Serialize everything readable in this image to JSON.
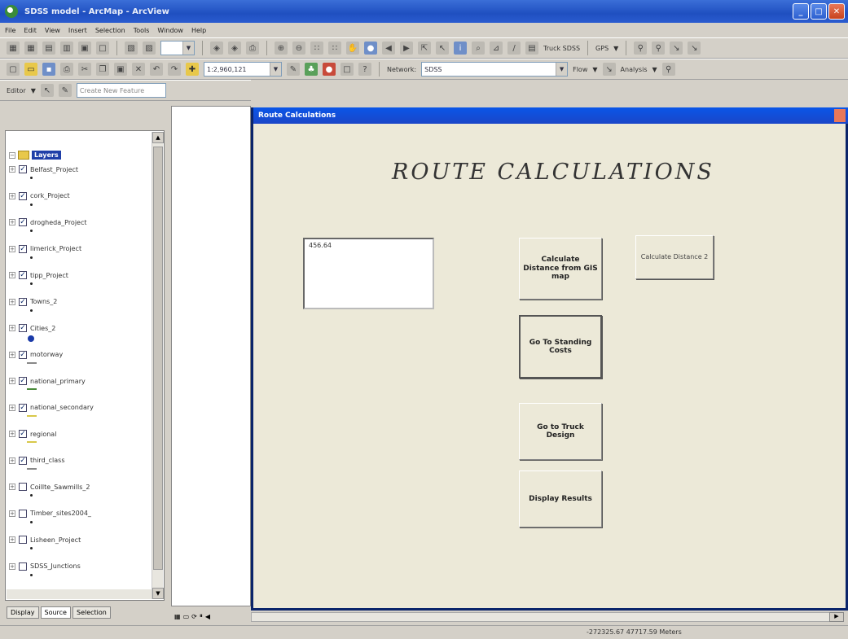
{
  "window": {
    "title": "SDSS model - ArcMap - ArcView"
  },
  "menu": [
    "File",
    "Edit",
    "View",
    "Insert",
    "Selection",
    "Tools",
    "Window",
    "Help"
  ],
  "toolbar": {
    "scale": "1:2,960,121",
    "layer_combo": "Truck SDSS",
    "gps_label": "GPS",
    "network_label": "Network:",
    "network_value": "SDSS",
    "flow_label": "Flow",
    "analysis_label": "Analysis",
    "editor_label": "Editor",
    "create_task": "Create New Feature"
  },
  "toc": {
    "root": "Layers",
    "layers": [
      {
        "label": "Belfast_Project",
        "checked": true
      },
      {
        "label": "cork_Project",
        "checked": true
      },
      {
        "label": "drogheda_Project",
        "checked": true
      },
      {
        "label": "limerick_Project",
        "checked": true
      },
      {
        "label": "tipp_Project",
        "checked": true
      },
      {
        "label": "Towns_2",
        "checked": true
      },
      {
        "label": "Cities_2",
        "checked": true
      },
      {
        "label": "motorway",
        "checked": true
      },
      {
        "label": "national_primary",
        "checked": true
      },
      {
        "label": "national_secondary",
        "checked": true
      },
      {
        "label": "regional",
        "checked": true
      },
      {
        "label": "third_class",
        "checked": true
      },
      {
        "label": "Coillte_Sawmills_2",
        "checked": false
      },
      {
        "label": "Timber_sites2004_",
        "checked": false
      },
      {
        "label": "Lisheen_Project",
        "checked": false
      },
      {
        "label": "SDSS_Junctions",
        "checked": false
      }
    ],
    "tabs": [
      "Display",
      "Source",
      "Selection"
    ]
  },
  "form": {
    "title": "Route Calculations",
    "heading": "ROUTE CALCULATIONS",
    "result_value": "456.64",
    "buttons": {
      "calc_gis": "Calculate Distance from GIS map",
      "calc2": "Calculate Distance 2",
      "standing": "Go To Standing Costs",
      "truck": "Go to Truck Design",
      "results": "Display Results"
    }
  },
  "status": {
    "coords": "-272325.67  47717.59 Meters"
  }
}
